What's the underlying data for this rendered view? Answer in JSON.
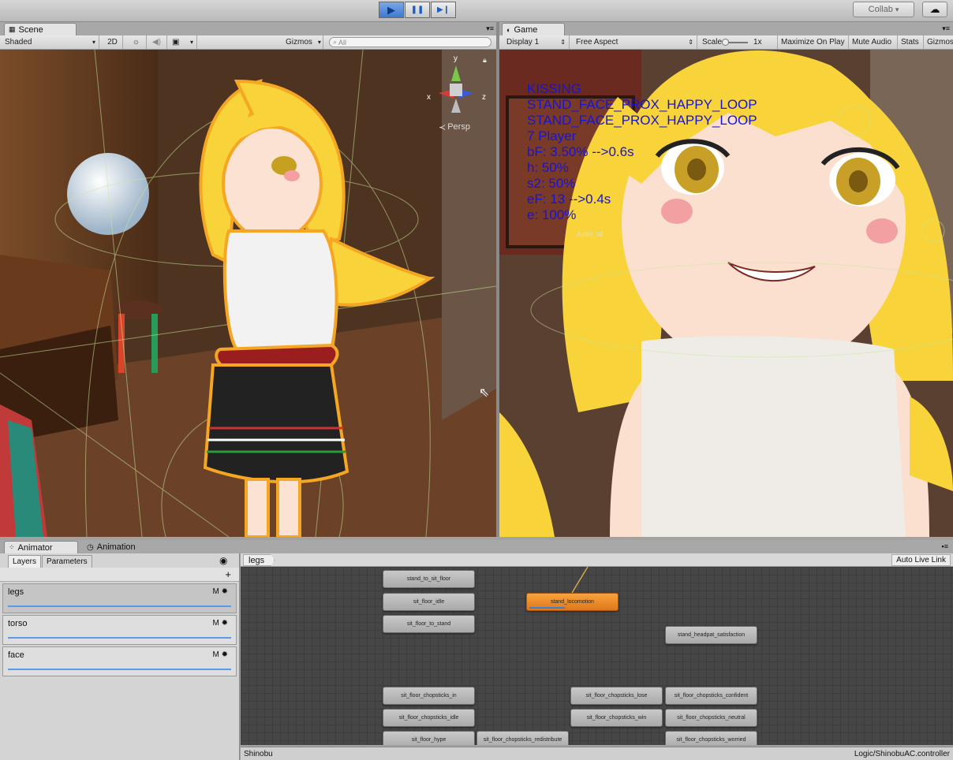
{
  "toolbar": {
    "collab_label": "Collab",
    "collab_arrow": "▾",
    "play_icon": "▶",
    "pause_icon": "❚❚",
    "step_icon": "▶❙",
    "cloud_icon": "☁"
  },
  "scene": {
    "tab_label": "Scene",
    "shading_mode": "Shaded",
    "mode_2d": "2D",
    "gizmos_label": "Gizmos",
    "search_placeholder": "All",
    "gizmo_y": "y",
    "gizmo_x": "x",
    "gizmo_z": "z",
    "persp_label": "Persp"
  },
  "game": {
    "tab_label": "Game",
    "display": "Display 1",
    "aspect": "Free Aspect",
    "scale_label": "Scale",
    "scale_value": "1x",
    "maximize_on_play": "Maximize On Play",
    "mute_audio": "Mute Audio",
    "stats": "Stats",
    "gizmos": "Gizmos",
    "painting_label": "Asl89_04",
    "overlay_lines": [
      "KISSING",
      "STAND_FACE_PROX_HAPPY_LOOP",
      "STAND_FACE_PROX_HAPPY_LOOP",
      "7 Player",
      "bF: 3.50% -->0.6s",
      "h: 50%",
      "s2: 50%",
      "eF: 13 -->0.4s",
      "e: 100%"
    ]
  },
  "animator": {
    "tab_label": "Animator",
    "animation_tab_label": "Animation",
    "layers_tab": "Layers",
    "parameters_tab": "Parameters",
    "add_symbol": "+",
    "breadcrumb": "legs",
    "auto_live_link": "Auto Live Link",
    "layers": [
      {
        "name": "legs",
        "m": "M"
      },
      {
        "name": "torso",
        "m": "M"
      },
      {
        "name": "face",
        "m": "M"
      }
    ],
    "states": [
      "stand_to_sit_floor",
      "sit_floor_idle",
      "sit_floor_to_stand",
      "stand_locomotion",
      "stand_headpat_satisfaction",
      "sit_floor_chopsticks_in",
      "sit_floor_chopsticks_idle",
      "sit_floor_hype",
      "sit_floor_chopsticks_redistribute",
      "sit_floor_chopsticks_lose",
      "sit_floor_chopsticks_win",
      "sit_floor_chopsticks_confident",
      "sit_floor_chopsticks_neutral",
      "sit_floor_chopsticks_worried"
    ],
    "active_state": "stand_locomotion",
    "status_left": "Shinobu",
    "status_right": "Logic/ShinobuAC.controller"
  },
  "colors": {
    "overlay_text": "#1515d8",
    "active_state": "#f08c2a",
    "selection_outline": "#f5a623",
    "hair": "#f8d33a"
  }
}
